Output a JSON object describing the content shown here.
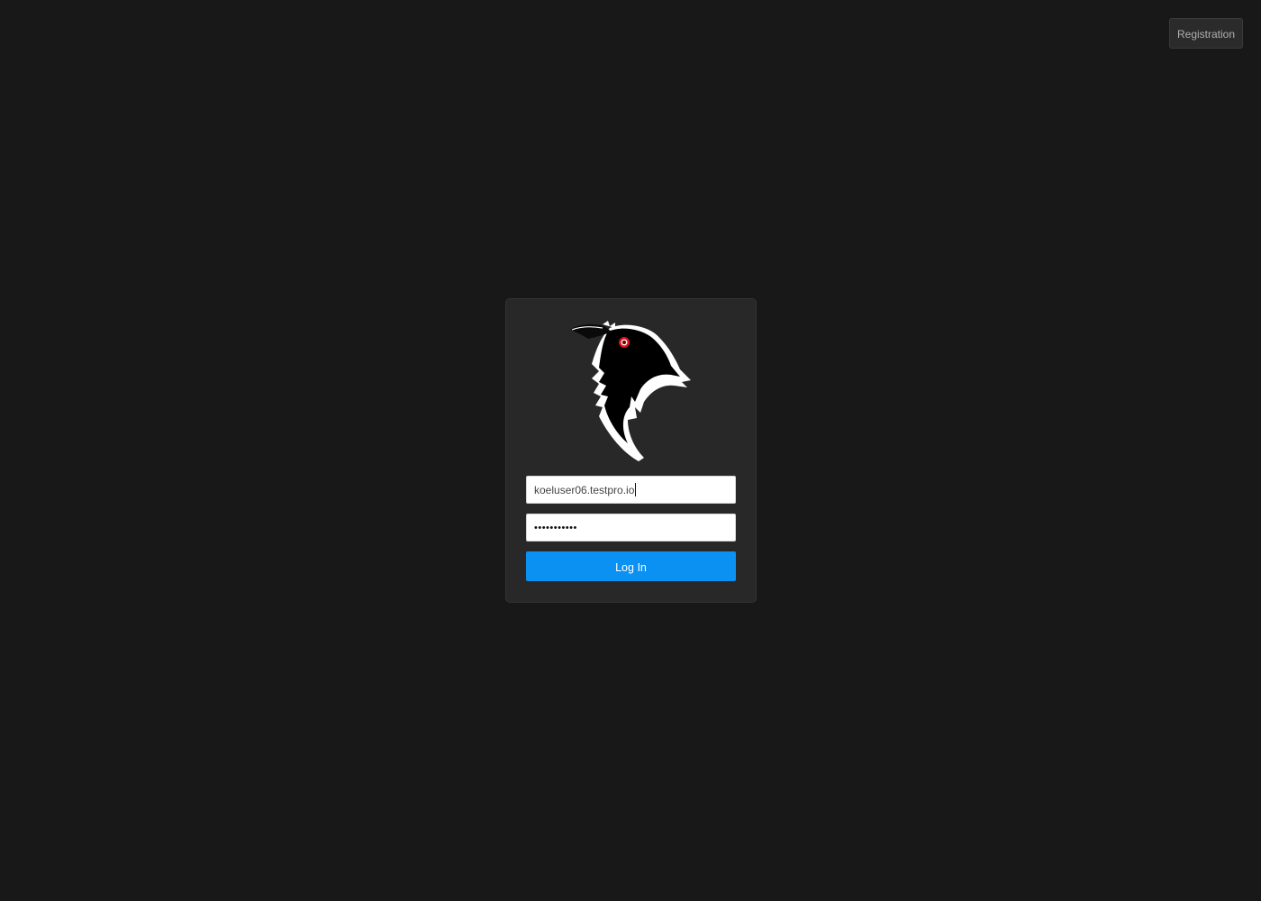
{
  "header": {
    "registration_label": "Registration"
  },
  "login": {
    "email_value": "koeluser06.testpro.io",
    "password_mask": "•••••••••••",
    "submit_label": "Log In"
  },
  "logo": {
    "icon": "raven-logo",
    "eye_color": "#e0101a"
  },
  "colors": {
    "background": "#181818",
    "card": "#282828",
    "accent": "#0a91f2"
  }
}
